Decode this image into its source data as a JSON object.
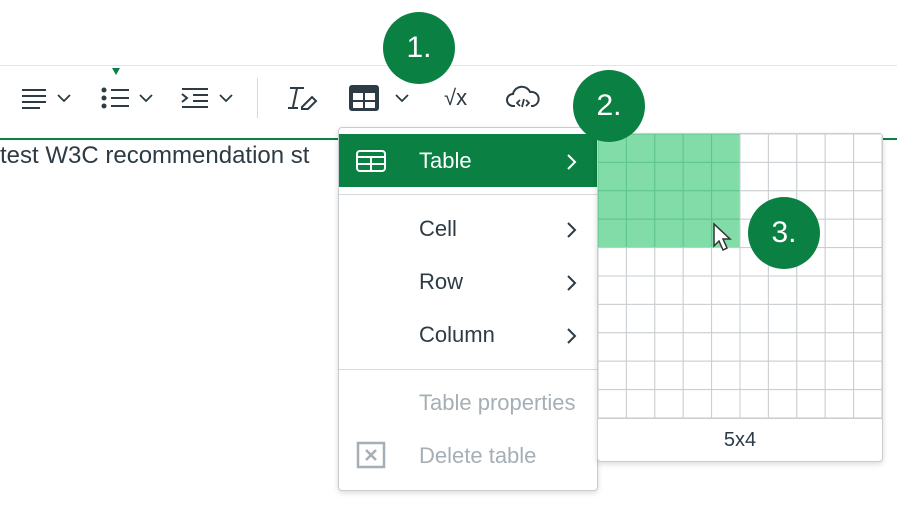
{
  "editor": {
    "visible_text": "test W3C recommendation st"
  },
  "toolbar": {
    "items": [
      {
        "name": "align-icon",
        "has_dropdown": true
      },
      {
        "name": "bullet-list-icon",
        "has_dropdown": true
      },
      {
        "name": "indent-icon",
        "has_dropdown": true
      },
      {
        "name": "clear-formatting-icon",
        "has_dropdown": false
      },
      {
        "name": "table-icon",
        "has_dropdown": true
      },
      {
        "name": "equation-icon",
        "has_dropdown": false
      },
      {
        "name": "cloud-embed-icon",
        "has_dropdown": false
      }
    ],
    "equation_glyph": "√x"
  },
  "callouts": {
    "one": "1.",
    "two": "2.",
    "three": "3."
  },
  "table_menu": {
    "items": [
      {
        "label": "Table",
        "has_submenu": true,
        "active": true,
        "icon": "table-icon"
      },
      {
        "label": "Cell",
        "has_submenu": true
      },
      {
        "label": "Row",
        "has_submenu": true
      },
      {
        "label": "Column",
        "has_submenu": true
      },
      {
        "label": "Table properties",
        "disabled": true
      },
      {
        "label": "Delete table",
        "disabled": true,
        "icon": "delete-table-icon"
      }
    ]
  },
  "table_grid": {
    "columns": 10,
    "rows": 10,
    "selected_columns": 5,
    "selected_rows": 4,
    "size_label": "5x4"
  },
  "colors": {
    "accent": "#0b8043",
    "grid_highlight": "#82dca8",
    "text": "#2d3b45",
    "disabled": "#a5afb5"
  }
}
